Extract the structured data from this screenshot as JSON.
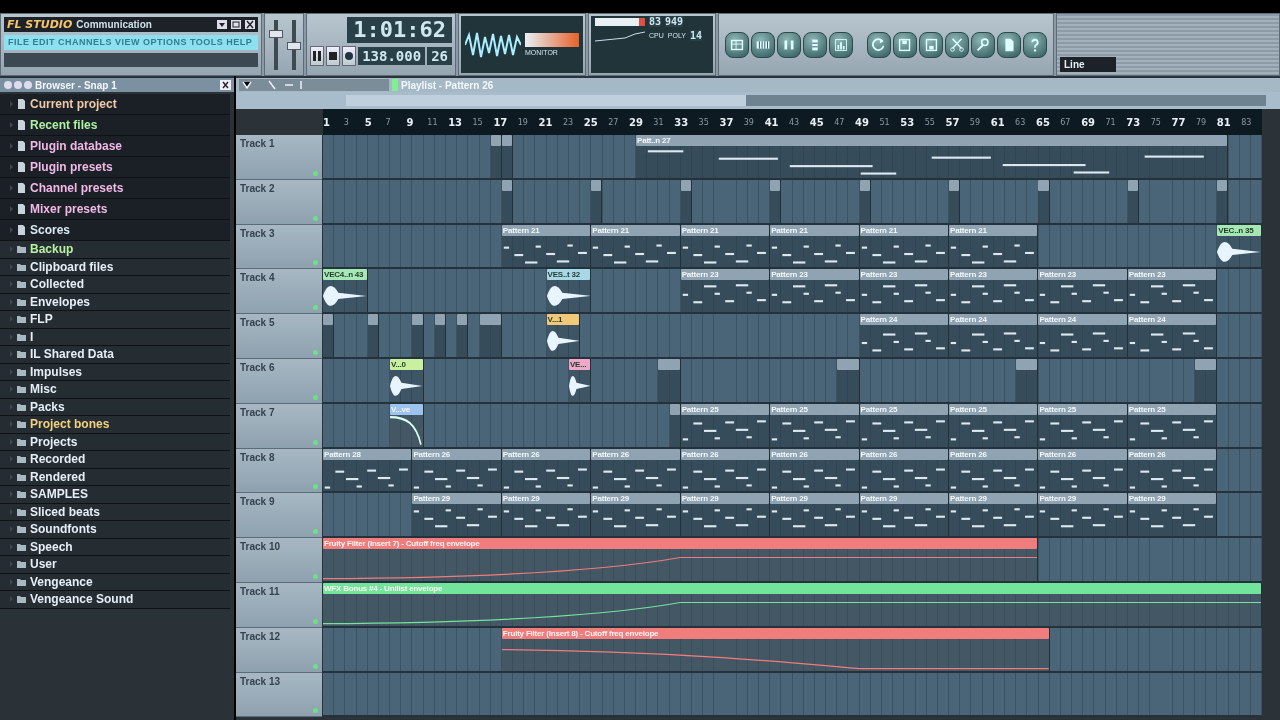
{
  "toolbar": {
    "logo": "FL STUDIO",
    "hint": "Communication",
    "menu": "FILE EDIT CHANNELS VIEW OPTIONS TOOLS HELP",
    "volume": {
      "level": 0.75
    },
    "pitch": {
      "level": 0.45
    },
    "time": "1:01:62",
    "tempo": "138.000",
    "pattern": "26",
    "cpu": "83",
    "ram": "949",
    "poly": "14",
    "poly_label": "POLY",
    "cpu_label": "CPU",
    "monitor_label": "MONITOR",
    "snap": "Line"
  },
  "browser": {
    "title": "Browser - Snap 1",
    "items": [
      {
        "label": "Current project",
        "kind": "shortcut",
        "color": "#f2c9a8"
      },
      {
        "label": "Recent files",
        "kind": "shortcut",
        "color": "#aef0a2"
      },
      {
        "label": "Plugin database",
        "kind": "shortcut",
        "color": "#f2b8e6"
      },
      {
        "label": "Plugin presets",
        "kind": "shortcut",
        "color": "#f2b8e6"
      },
      {
        "label": "Channel presets",
        "kind": "shortcut",
        "color": "#f2b8e6"
      },
      {
        "label": "Mixer presets",
        "kind": "shortcut",
        "color": "#f2b8e6"
      },
      {
        "label": "Scores",
        "kind": "shortcut",
        "color": "#dbe8f2"
      },
      {
        "label": "Backup",
        "kind": "folder",
        "color": "#b6f2a0"
      },
      {
        "label": "Clipboard files",
        "kind": "folder",
        "color": "#e6eef6"
      },
      {
        "label": "Collected",
        "kind": "folder",
        "color": "#e6eef6"
      },
      {
        "label": "Envelopes",
        "kind": "folder",
        "color": "#e6eef6"
      },
      {
        "label": "FLP",
        "kind": "folder",
        "color": "#e6eef6"
      },
      {
        "label": "I",
        "kind": "folder",
        "color": "#e6eef6"
      },
      {
        "label": "IL Shared Data",
        "kind": "folder",
        "color": "#e6eef6"
      },
      {
        "label": "Impulses",
        "kind": "folder",
        "color": "#e6eef6"
      },
      {
        "label": "Misc",
        "kind": "folder",
        "color": "#e6eef6"
      },
      {
        "label": "Packs",
        "kind": "folder",
        "color": "#e6eef6"
      },
      {
        "label": "Project bones",
        "kind": "folder",
        "color": "#f2d27e"
      },
      {
        "label": "Projects",
        "kind": "folder",
        "color": "#e6eef6"
      },
      {
        "label": "Recorded",
        "kind": "folder",
        "color": "#e6eef6"
      },
      {
        "label": "Rendered",
        "kind": "folder",
        "color": "#e6eef6"
      },
      {
        "label": "SAMPLES",
        "kind": "folder",
        "color": "#e6eef6"
      },
      {
        "label": "Sliced beats",
        "kind": "folder",
        "color": "#e6eef6"
      },
      {
        "label": "Soundfonts",
        "kind": "folder",
        "color": "#e6eef6"
      },
      {
        "label": "Speech",
        "kind": "folder",
        "color": "#e6eef6"
      },
      {
        "label": "User",
        "kind": "folder",
        "color": "#e6eef6"
      },
      {
        "label": "Vengeance",
        "kind": "folder",
        "color": "#e6eef6"
      },
      {
        "label": "Vengeance Sound",
        "kind": "folder",
        "color": "#e6eef6"
      }
    ]
  },
  "playlist": {
    "title": "Playlist - Pattern 26",
    "ruler": [
      "1",
      "3",
      "5",
      "7",
      "9",
      "11",
      "13",
      "15",
      "17",
      "19",
      "21",
      "23",
      "25",
      "27",
      "29",
      "31",
      "33",
      "35",
      "37",
      "39",
      "41",
      "43",
      "45",
      "47",
      "49",
      "51",
      "53",
      "55",
      "57",
      "59",
      "61",
      "63",
      "65",
      "67",
      "69",
      "71",
      "73",
      "75",
      "77",
      "79",
      "81",
      "83"
    ],
    "tracks": [
      {
        "name": "Track 1",
        "enabled": true,
        "clips": [
          {
            "kind": "pattern"
          },
          {
            "kind": "pattern"
          },
          {
            "kind": "pattern",
            "label": "Patt..n 27"
          }
        ]
      },
      {
        "name": "Track 2",
        "enabled": true,
        "clips": [
          {
            "kind": "pattern"
          },
          {
            "kind": "pattern"
          },
          {
            "kind": "pattern"
          },
          {
            "kind": "pattern"
          },
          {
            "kind": "pattern"
          },
          {
            "kind": "pattern"
          },
          {
            "kind": "pattern"
          },
          {
            "kind": "pattern"
          },
          {
            "kind": "pattern"
          }
        ]
      },
      {
        "name": "Track 3",
        "enabled": true,
        "clips": [
          {
            "kind": "pattern",
            "label": "Pattern 21"
          },
          {
            "kind": "pattern",
            "label": "Pattern 21"
          },
          {
            "kind": "pattern",
            "label": "Pattern 21"
          },
          {
            "kind": "pattern",
            "label": "Pattern 21"
          },
          {
            "kind": "pattern",
            "label": "Pattern 21"
          },
          {
            "kind": "pattern",
            "label": "Pattern 21"
          },
          {
            "kind": "audio",
            "label": "VEC..n 35",
            "color": "#a6e8b4"
          }
        ]
      },
      {
        "name": "Track 4",
        "enabled": true,
        "clips": [
          {
            "kind": "audio",
            "label": "VEC4..n 43",
            "color": "#a6e8b4"
          },
          {
            "kind": "audio",
            "label": "VES..t 32",
            "color": "#a8d8e8"
          },
          {
            "kind": "pattern",
            "label": "Pattern 23"
          },
          {
            "kind": "pattern",
            "label": "Pattern 23"
          },
          {
            "kind": "pattern",
            "label": "Pattern 23"
          },
          {
            "kind": "pattern",
            "label": "Pattern 23"
          },
          {
            "kind": "pattern",
            "label": "Pattern 23"
          },
          {
            "kind": "pattern",
            "label": "Pattern 23"
          }
        ]
      },
      {
        "name": "Track 5",
        "enabled": true,
        "clips": [
          {
            "kind": "pattern"
          },
          {
            "kind": "pattern"
          },
          {
            "kind": "pattern"
          },
          {
            "kind": "pattern"
          },
          {
            "kind": "pattern"
          },
          {
            "kind": "pattern"
          },
          {
            "kind": "audio",
            "label": "V...1",
            "color": "#f0c878"
          },
          {
            "kind": "pattern",
            "label": "Pattern 24"
          },
          {
            "kind": "pattern",
            "label": "Pattern 24"
          },
          {
            "kind": "pattern",
            "label": "Pattern 24"
          },
          {
            "kind": "pattern",
            "label": "Pattern 24"
          }
        ]
      },
      {
        "name": "Track 6",
        "enabled": true,
        "clips": [
          {
            "kind": "audio",
            "label": "V...0",
            "color": "#c8f0a0"
          },
          {
            "kind": "audio",
            "label": "VE...",
            "color": "#f0a8c8"
          },
          {
            "kind": "pattern"
          },
          {
            "kind": "pattern"
          },
          {
            "kind": "pattern"
          },
          {
            "kind": "pattern"
          }
        ]
      },
      {
        "name": "Track 7",
        "enabled": true,
        "clips": [
          {
            "kind": "automation",
            "label": "V...ve",
            "color": "#9cc4f0"
          },
          {
            "kind": "pattern"
          },
          {
            "kind": "pattern",
            "label": "Pattern 25"
          },
          {
            "kind": "pattern",
            "label": "Pattern 25"
          },
          {
            "kind": "pattern",
            "label": "Pattern 25"
          },
          {
            "kind": "pattern",
            "label": "Pattern 25"
          },
          {
            "kind": "pattern",
            "label": "Pattern 25"
          },
          {
            "kind": "pattern",
            "label": "Pattern 25"
          }
        ]
      },
      {
        "name": "Track 8",
        "enabled": true,
        "clips": [
          {
            "kind": "pattern",
            "label": "Pattern 28"
          },
          {
            "kind": "pattern",
            "label": "Pattern 26"
          },
          {
            "kind": "pattern",
            "label": "Pattern 26"
          },
          {
            "kind": "pattern",
            "label": "Pattern 26"
          },
          {
            "kind": "pattern",
            "label": "Pattern 26"
          },
          {
            "kind": "pattern",
            "label": "Pattern 26"
          },
          {
            "kind": "pattern",
            "label": "Pattern 26"
          },
          {
            "kind": "pattern",
            "label": "Pattern 26"
          },
          {
            "kind": "pattern",
            "label": "Pattern 26"
          },
          {
            "kind": "pattern",
            "label": "Pattern 26"
          }
        ]
      },
      {
        "name": "Track 9",
        "enabled": true,
        "clips": [
          {
            "kind": "pattern",
            "label": "Pattern 29"
          },
          {
            "kind": "pattern",
            "label": "Pattern 29"
          },
          {
            "kind": "pattern",
            "label": "Pattern 29"
          },
          {
            "kind": "pattern",
            "label": "Pattern 29"
          },
          {
            "kind": "pattern",
            "label": "Pattern 29"
          },
          {
            "kind": "pattern",
            "label": "Pattern 29"
          },
          {
            "kind": "pattern",
            "label": "Pattern 29"
          },
          {
            "kind": "pattern",
            "label": "Pattern 29"
          },
          {
            "kind": "pattern",
            "label": "Pattern 29"
          }
        ]
      },
      {
        "name": "Track 10",
        "enabled": true,
        "clips": [
          {
            "kind": "automation",
            "label": "Fruity Filter (Insert 7) - Cutoff freq envelope",
            "color": "#f07c7c"
          }
        ]
      },
      {
        "name": "Track 11",
        "enabled": true,
        "clips": [
          {
            "kind": "automation",
            "label": "WFX Bonus #4 - Unilist envelope",
            "color": "#72e49c"
          }
        ]
      },
      {
        "name": "Track 12",
        "enabled": true,
        "clips": [
          {
            "kind": "automation",
            "label": "Fruity Filter (Insert 8) - Cutoff freq envelope",
            "color": "#f07c7c"
          }
        ]
      },
      {
        "name": "Track 13",
        "enabled": true
      }
    ]
  }
}
